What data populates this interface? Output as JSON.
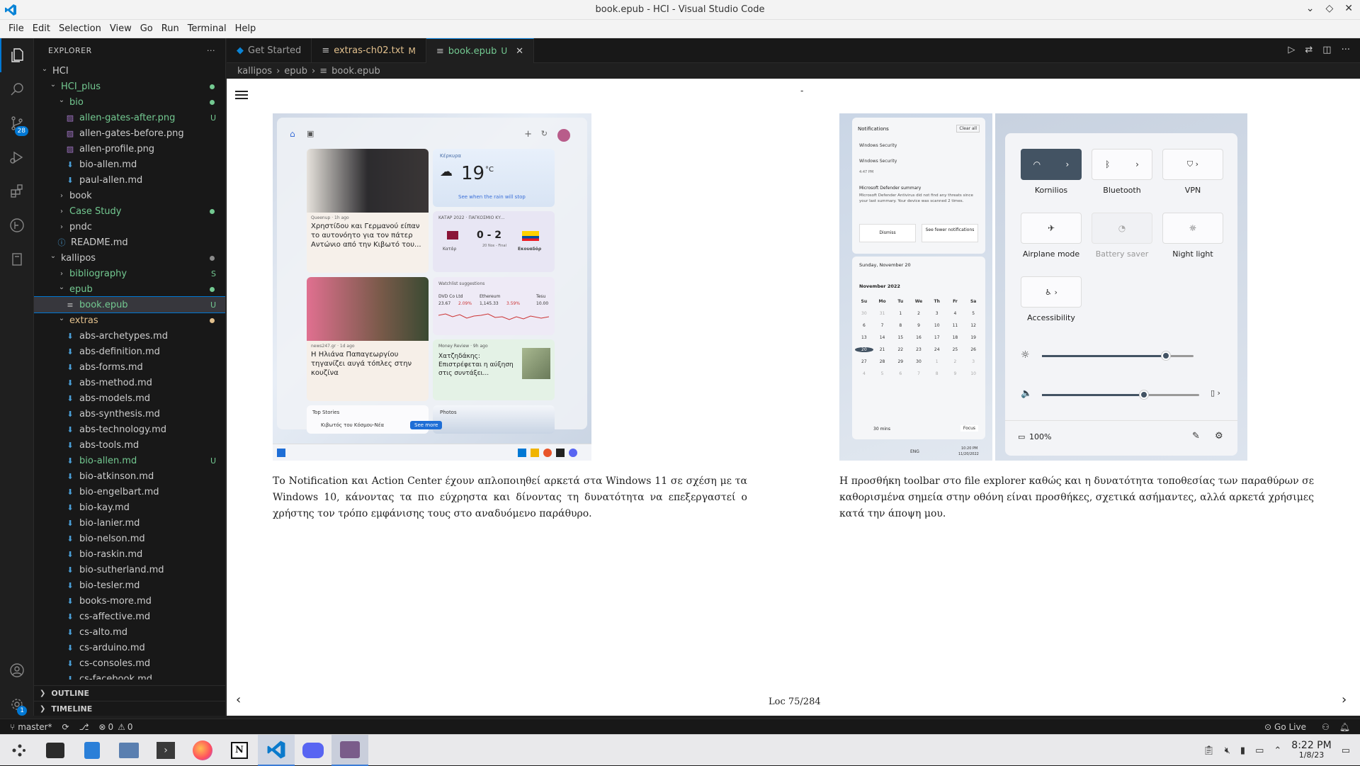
{
  "window": {
    "title": "book.epub - HCI - Visual Studio Code"
  },
  "menu": [
    "File",
    "Edit",
    "Selection",
    "View",
    "Go",
    "Run",
    "Terminal",
    "Help"
  ],
  "activity": {
    "scm_badge": "28",
    "settings_badge": "1"
  },
  "explorer": {
    "header": "EXPLORER",
    "more": "···",
    "items": [
      {
        "label": "HCI",
        "depth": 0,
        "type": "root",
        "chev": "v",
        "color": "w"
      },
      {
        "label": "HCI_plus",
        "depth": 1,
        "type": "folder",
        "chev": "v",
        "color": "g",
        "dot": "#73c991"
      },
      {
        "label": "bio",
        "depth": 2,
        "type": "folder",
        "chev": "v",
        "color": "g",
        "dot": "#73c991"
      },
      {
        "label": "allen-gates-after.png",
        "depth": 3,
        "type": "img",
        "color": "g",
        "status": "U"
      },
      {
        "label": "allen-gates-before.png",
        "depth": 3,
        "type": "img",
        "color": "w"
      },
      {
        "label": "allen-profile.png",
        "depth": 3,
        "type": "img",
        "color": "w"
      },
      {
        "label": "bio-allen.md",
        "depth": 3,
        "type": "md",
        "color": "w"
      },
      {
        "label": "paul-allen.md",
        "depth": 3,
        "type": "md",
        "color": "w"
      },
      {
        "label": "book",
        "depth": 2,
        "type": "folder",
        "chev": ">",
        "color": "w"
      },
      {
        "label": "Case Study",
        "depth": 2,
        "type": "folder",
        "chev": ">",
        "color": "g",
        "dot": "#73c991"
      },
      {
        "label": "pndc",
        "depth": 2,
        "type": "folder",
        "chev": ">",
        "color": "w"
      },
      {
        "label": "README.md",
        "depth": 2,
        "type": "info",
        "color": "w"
      },
      {
        "label": "kallipos",
        "depth": 1,
        "type": "folder",
        "chev": "v",
        "color": "w",
        "dot": "#8a8a8a"
      },
      {
        "label": "bibliography",
        "depth": 2,
        "type": "folder",
        "chev": ">",
        "color": "g",
        "status": "S"
      },
      {
        "label": "epub",
        "depth": 2,
        "type": "folder",
        "chev": "v",
        "color": "g",
        "dot": "#73c991"
      },
      {
        "label": "book.epub",
        "depth": 3,
        "type": "file",
        "color": "g",
        "status": "U",
        "selected": true
      },
      {
        "label": "extras",
        "depth": 2,
        "type": "folder",
        "chev": "v",
        "color": "y",
        "dot": "#e2c08d"
      },
      {
        "label": "abs-archetypes.md",
        "depth": 3,
        "type": "md",
        "color": "w"
      },
      {
        "label": "abs-definition.md",
        "depth": 3,
        "type": "md",
        "color": "w"
      },
      {
        "label": "abs-forms.md",
        "depth": 3,
        "type": "md",
        "color": "w"
      },
      {
        "label": "abs-method.md",
        "depth": 3,
        "type": "md",
        "color": "w"
      },
      {
        "label": "abs-models.md",
        "depth": 3,
        "type": "md",
        "color": "w"
      },
      {
        "label": "abs-synthesis.md",
        "depth": 3,
        "type": "md",
        "color": "w"
      },
      {
        "label": "abs-technology.md",
        "depth": 3,
        "type": "md",
        "color": "w"
      },
      {
        "label": "abs-tools.md",
        "depth": 3,
        "type": "md",
        "color": "w"
      },
      {
        "label": "bio-allen.md",
        "depth": 3,
        "type": "md",
        "color": "g",
        "status": "U"
      },
      {
        "label": "bio-atkinson.md",
        "depth": 3,
        "type": "md",
        "color": "w"
      },
      {
        "label": "bio-engelbart.md",
        "depth": 3,
        "type": "md",
        "color": "w"
      },
      {
        "label": "bio-kay.md",
        "depth": 3,
        "type": "md",
        "color": "w"
      },
      {
        "label": "bio-lanier.md",
        "depth": 3,
        "type": "md",
        "color": "w"
      },
      {
        "label": "bio-nelson.md",
        "depth": 3,
        "type": "md",
        "color": "w"
      },
      {
        "label": "bio-raskin.md",
        "depth": 3,
        "type": "md",
        "color": "w"
      },
      {
        "label": "bio-sutherland.md",
        "depth": 3,
        "type": "md",
        "color": "w"
      },
      {
        "label": "bio-tesler.md",
        "depth": 3,
        "type": "md",
        "color": "w"
      },
      {
        "label": "books-more.md",
        "depth": 3,
        "type": "md",
        "color": "w"
      },
      {
        "label": "cs-affective.md",
        "depth": 3,
        "type": "md",
        "color": "w"
      },
      {
        "label": "cs-alto.md",
        "depth": 3,
        "type": "md",
        "color": "w"
      },
      {
        "label": "cs-arduino.md",
        "depth": 3,
        "type": "md",
        "color": "w"
      },
      {
        "label": "cs-consoles.md",
        "depth": 3,
        "type": "md",
        "color": "w"
      },
      {
        "label": "cs-facebook.md",
        "depth": 3,
        "type": "md",
        "color": "w"
      }
    ],
    "outline": "OUTLINE",
    "timeline": "TIMELINE"
  },
  "tabs": [
    {
      "label": "Get Started",
      "icon": "vscode",
      "mod": "",
      "active": false
    },
    {
      "label": "extras-ch02.txt",
      "icon": "txt",
      "mod": "M",
      "active": false
    },
    {
      "label": "book.epub",
      "icon": "txt",
      "mod": "U",
      "active": true
    }
  ],
  "breadcrumb": [
    "kallipos",
    "epub",
    "book.epub"
  ],
  "reader": {
    "top_mark": "-",
    "left_text": "Το Notification και Action Center έχουν απλοποιηθεί αρκετά στα Windows 11 σε σχέση με τα Windows 10, κάνοντας τα πιο εύχρηστα και δίνοντας τη δυνατότητα να επεξεργαστεί ο χρήστης τον τρόπο εμφάνισης τους στο αναδυόμενο παράθυρο.",
    "right_text": "Η προσθήκη toolbar στο file explorer καθώς και η δυνατότητα τοποθεσίας των παραθύρων σε καθορισμένα σημεία στην οθόνη είναι προσθήκες, σχετικά ασήμαντες, αλλά αρκετά χρήσιμες κατά την άποψη μου.",
    "location": "Loc 75/284",
    "widgets": {
      "weather_label": "Κέρκυρα",
      "temp": "19",
      "unit": "°C",
      "weather_note": "See when the rain will stop",
      "news1_source": "Queenup · 1h ago",
      "news1": "Χρηστίδου και Γερμανού είπαν το αυτονόητο για τον πάτερ Αντώνιο από την Κιβωτό του...",
      "sports_head": "ΚΑΤΑΡ 2022 · ΠΑΓΚΟΣΜΙΟ ΚΥ...",
      "score": "0 - 2",
      "team1": "Κατάρ",
      "team2": "Εκουαδόρ",
      "score_time": "20 Νοε - Final",
      "watch_head": "Watchlist suggestions",
      "stock1": "DVD Co Ltd",
      "stock1_val": "23.67",
      "stock1_chg": "2.09%",
      "stock2": "Ethereum",
      "stock2_val": "1,145.33",
      "stock2_chg": "3.59%",
      "stock3": "Tesu",
      "stock3_val": "10.00",
      "news2_source": "news247.gr · 1d ago",
      "news2": "Η Ηλιάνα Παπαγεωργίου τηγανίζει αυγά τόπλες στην κουζίνα",
      "news3_source": "Money Review · 9h ago",
      "news3": "Χατζηδάκης: Επιστρέφεται η αύξηση στις συντάξει...",
      "top_stories": "Top Stories",
      "news4": "Κιβωτός του Κόσμου-Νέα",
      "see_more": "See more",
      "photos": "Photos"
    },
    "notif": {
      "title": "Notifications",
      "clear": "Clear all",
      "app": "Windows Security",
      "app2": "Windows Security",
      "time": "4:47 PM",
      "head": "Microsoft Defender summary",
      "body": "Microsoft Defender Antivirus did not find any threats since your last summary. Your device was scanned 2 times.",
      "dismiss": "Dismiss",
      "fewer": "See fewer notifications",
      "date": "Sunday, November 20",
      "month": "November 2022",
      "days": [
        "Su",
        "Mo",
        "Tu",
        "We",
        "Th",
        "Fr",
        "Sa"
      ],
      "cal": [
        "30",
        "31",
        "1",
        "2",
        "3",
        "4",
        "5",
        "6",
        "7",
        "8",
        "9",
        "10",
        "11",
        "12",
        "13",
        "14",
        "15",
        "16",
        "17",
        "18",
        "19",
        "20",
        "21",
        "22",
        "23",
        "24",
        "25",
        "26",
        "27",
        "28",
        "29",
        "30",
        "1",
        "2",
        "3",
        "4",
        "5",
        "6",
        "7",
        "8",
        "9",
        "10"
      ],
      "focus_time": "30 mins",
      "focus": "Focus",
      "lang": "ENG",
      "clock": "10:20 PM",
      "clock_date": "11/20/2022"
    },
    "quick": {
      "wifi": "Kornilios",
      "bluetooth": "Bluetooth",
      "vpn": "VPN",
      "airplane": "Airplane mode",
      "battery_saver": "Battery saver",
      "night": "Night light",
      "access": "Accessibility",
      "brightness": 0.82,
      "volume": 0.65,
      "battery": "100%"
    }
  },
  "status": {
    "branch": "master*",
    "errors": "0",
    "warnings": "0",
    "golive": "Go Live"
  },
  "taskbar": {
    "time": "8:22 PM",
    "date": "1/8/23"
  },
  "colors": {
    "accent": "#0078d4",
    "added": "#73c991",
    "modified": "#e2c08d"
  }
}
